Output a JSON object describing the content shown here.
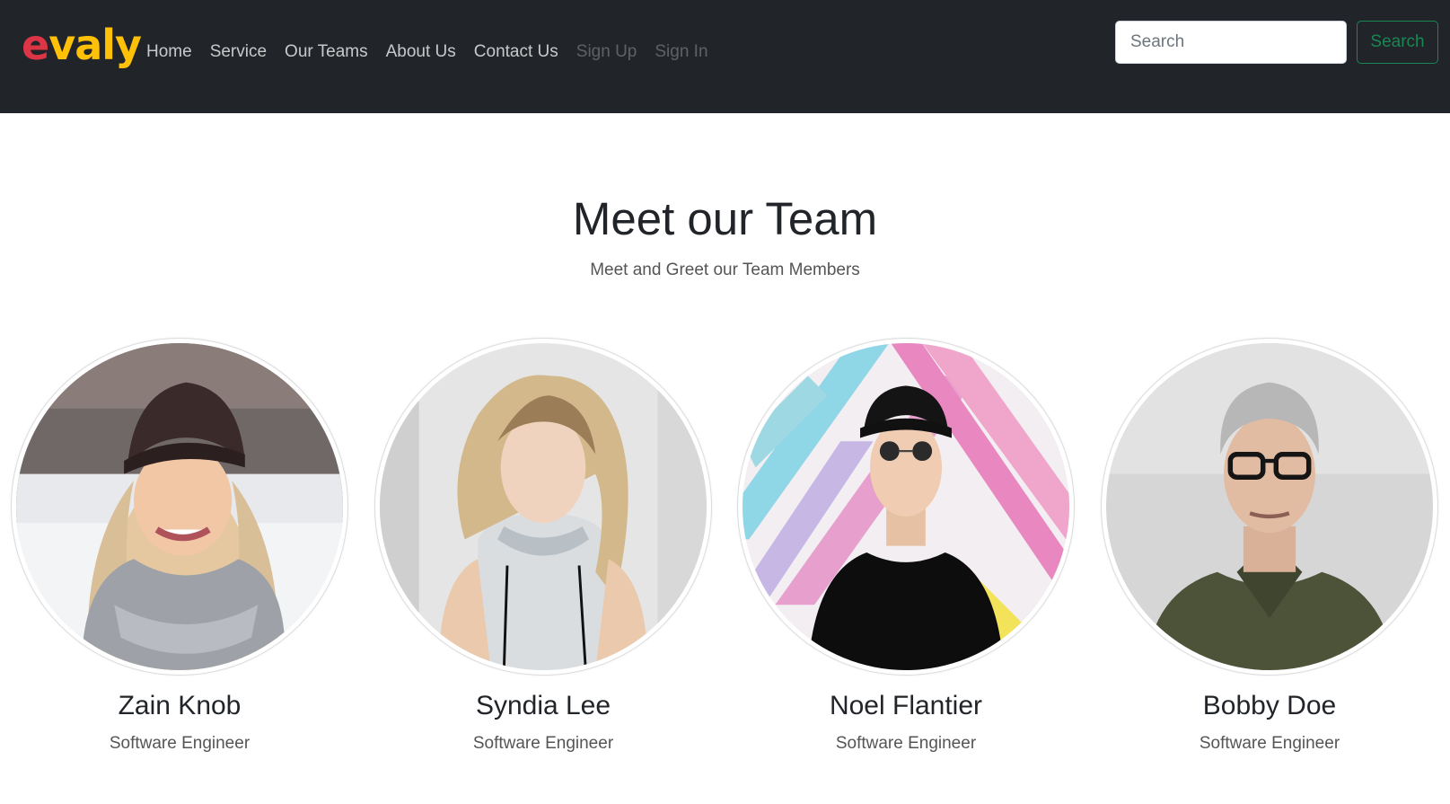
{
  "brand": {
    "first_letter": "e",
    "rest": "valy"
  },
  "nav": {
    "items": [
      {
        "label": "Home",
        "disabled": false
      },
      {
        "label": "Service",
        "disabled": false
      },
      {
        "label": "Our Teams",
        "disabled": false
      },
      {
        "label": "About Us",
        "disabled": false
      },
      {
        "label": "Contact Us",
        "disabled": false
      },
      {
        "label": "Sign Up",
        "disabled": true
      },
      {
        "label": "Sign In",
        "disabled": true
      }
    ]
  },
  "search": {
    "placeholder": "Search",
    "button_label": "Search"
  },
  "hero": {
    "title": "Meet our Team",
    "subtitle": "Meet and Greet our Team Members"
  },
  "team": [
    {
      "name": "Zain Knob",
      "role": "Software Engineer",
      "photo": "woman-in-beanie-and-scarf"
    },
    {
      "name": "Syndia Lee",
      "role": "Software Engineer",
      "photo": "blonde-woman-in-white-top"
    },
    {
      "name": "Noel Flantier",
      "role": "Software Engineer",
      "photo": "man-with-cap-and-sunglasses"
    },
    {
      "name": "Bobby Doe",
      "role": "Software Engineer",
      "photo": "man-with-glasses-green-polo"
    }
  ],
  "colors": {
    "navbar_bg": "#212529",
    "brand_e": "#dc3545",
    "brand_rest": "#ffc107",
    "search_button": "#198754"
  }
}
